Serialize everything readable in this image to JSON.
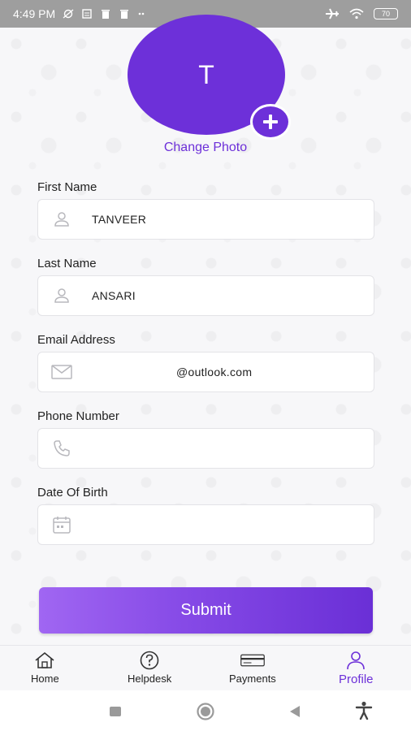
{
  "status_bar": {
    "time": "4:49 PM",
    "icons_left": [
      "sync-off-icon",
      "clipboard-icon",
      "trash-icon",
      "trash-icon",
      "more-icon"
    ],
    "icons_right": [
      "airplane-icon",
      "wifi-icon",
      "battery-icon"
    ],
    "battery": "70"
  },
  "profile": {
    "avatar_initial": "T",
    "change_photo_label": "Change Photo",
    "accent": "#6d30d9"
  },
  "form": {
    "first_name": {
      "label": "First Name",
      "value": "TANVEER",
      "icon": "person-icon"
    },
    "last_name": {
      "label": "Last Name",
      "value": "ANSARI",
      "icon": "person-icon"
    },
    "email": {
      "label": "Email Address",
      "value": "@outlook.com",
      "icon": "mail-icon"
    },
    "phone": {
      "label": "Phone Number",
      "value": "",
      "icon": "phone-icon"
    },
    "dob": {
      "label": "Date Of Birth",
      "value": "",
      "icon": "calendar-icon"
    },
    "submit_label": "Submit"
  },
  "bottom_nav": {
    "items": [
      {
        "label": "Home",
        "icon": "home-icon",
        "active": false
      },
      {
        "label": "Helpdesk",
        "icon": "help-circle-icon",
        "active": false
      },
      {
        "label": "Payments",
        "icon": "card-icon",
        "active": false
      },
      {
        "label": "Profile",
        "icon": "person-icon",
        "active": true
      }
    ]
  },
  "system_nav": [
    "recents-icon",
    "home-circle-icon",
    "back-icon",
    "accessibility-icon"
  ]
}
